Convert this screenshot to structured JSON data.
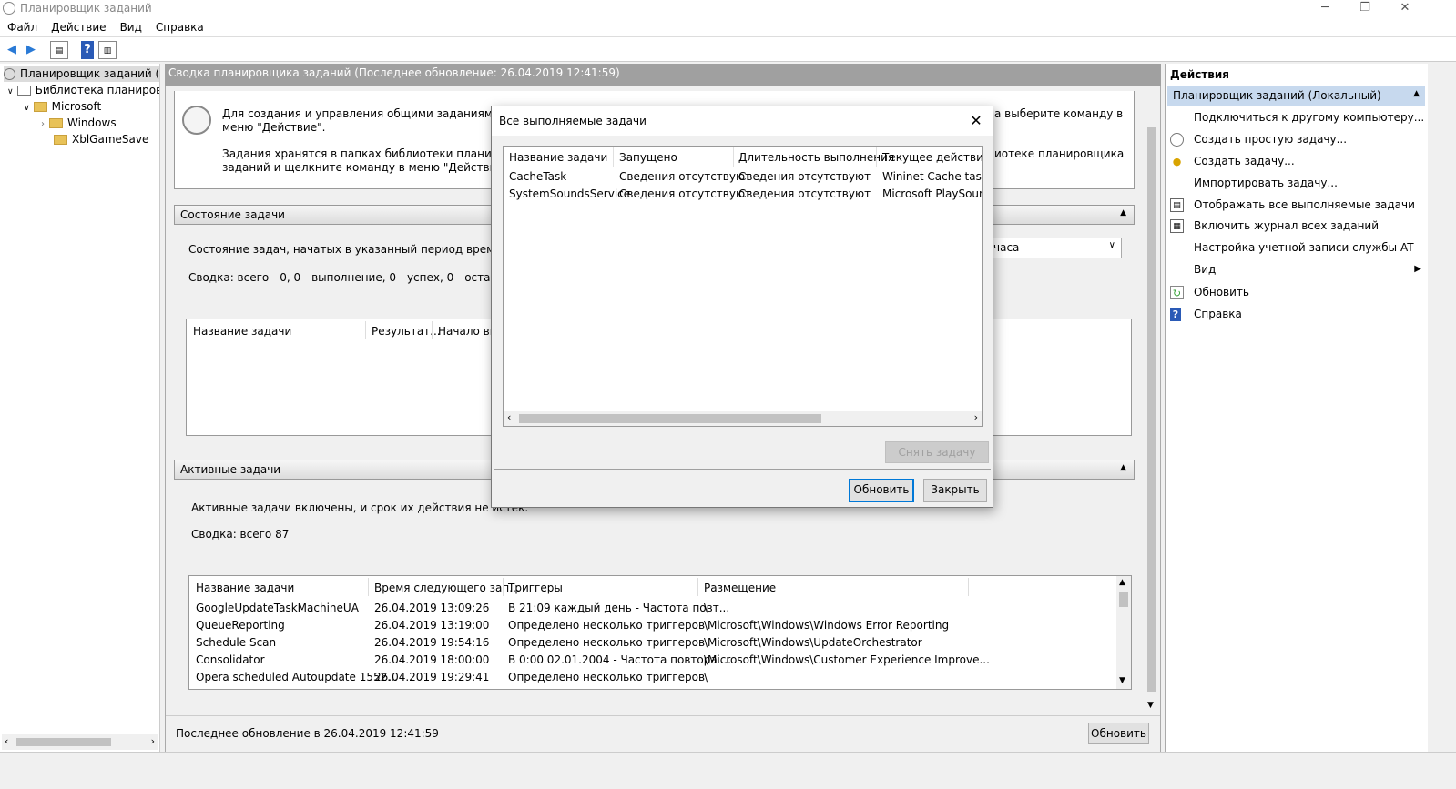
{
  "window": {
    "title": "Планировщик заданий"
  },
  "menu": [
    "Файл",
    "Действие",
    "Вид",
    "Справка"
  ],
  "tree": {
    "root": "Планировщик заданий (Локальный)",
    "library": "Библиотека планировщика заданий",
    "microsoft": "Microsoft",
    "windows": "Windows",
    "xbl": "XblGameSave"
  },
  "center": {
    "header": "Сводка планировщика заданий (Последнее обновление: 26.04.2019 12:41:59)",
    "intro": {
      "line1": "Для создания и управления общими заданиями, автом",
      "line1b": "а выберите команду в",
      "line2": "меню \"Действие\".",
      "line3": "Задания хранятся в папках библиотеки планировщика",
      "line3b": "иотеке планировщика",
      "line4": "заданий и щелкните команду в меню \"Действие\"."
    },
    "status_section": {
      "title": "Состояние задачи",
      "period_label": "Состояние задач, начатых в указанный период времени:",
      "period_value": "часа",
      "summary": "Сводка: всего - 0, 0 - выполнение, 0 - успех, 0 - остановлено, 0",
      "columns": [
        "Название задачи",
        "Результат...",
        "Начало вы"
      ]
    },
    "active_section": {
      "title": "Активные задачи",
      "desc": "Активные задачи включены, и срок их действия не истек.",
      "summary": "Сводка: всего 87",
      "columns": [
        "Название задачи",
        "Время следующего зап...",
        "Триггеры",
        "Размещение"
      ],
      "rows": [
        [
          "GoogleUpdateTaskMachineUA",
          "26.04.2019 13:09:26",
          "В 21:09 каждый день - Частота повт...",
          "\\"
        ],
        [
          "QueueReporting",
          "26.04.2019 13:19:00",
          "Определено несколько триггеров",
          "\\Microsoft\\Windows\\Windows Error Reporting"
        ],
        [
          "Schedule Scan",
          "26.04.2019 19:54:16",
          "Определено несколько триггеров",
          "\\Microsoft\\Windows\\UpdateOrchestrator"
        ],
        [
          "Consolidator",
          "26.04.2019 18:00:00",
          "В 0:00 02.01.2004 - Частота повтора ...",
          "\\Microsoft\\Windows\\Customer Experience Improve..."
        ],
        [
          "Opera scheduled Autoupdate 1552...",
          "26.04.2019 19:29:41",
          "Определено несколько триггеров",
          "\\"
        ]
      ]
    },
    "footer": {
      "last_update": "Последнее обновление в 26.04.2019 12:41:59",
      "refresh": "Обновить"
    }
  },
  "actions": {
    "title": "Действия",
    "group": "Планировщик заданий (Локальный)",
    "items": [
      {
        "label": "Подключиться к другому компьютеру...",
        "icon": "none"
      },
      {
        "label": "Создать простую задачу...",
        "icon": "clock-icon"
      },
      {
        "label": "Создать задачу...",
        "icon": "task-icon"
      },
      {
        "label": "Импортировать задачу...",
        "icon": "none"
      },
      {
        "label": "Отображать все выполняемые задачи",
        "icon": "list-icon"
      },
      {
        "label": "Включить журнал всех заданий",
        "icon": "log-icon"
      },
      {
        "label": "Настройка учетной записи службы AT",
        "icon": "none"
      },
      {
        "label": "Вид",
        "icon": "none"
      },
      {
        "label": "Обновить",
        "icon": "refresh-icon"
      },
      {
        "label": "Справка",
        "icon": "help-icon"
      }
    ]
  },
  "dialog": {
    "title": "Все выполняемые задачи",
    "columns": [
      "Название задачи",
      "Запущено",
      "Длительность выполнения",
      "Текущее действие"
    ],
    "rows": [
      [
        "CacheTask",
        "Сведения отсутствуют",
        "Сведения отсутствуют",
        "Wininet Cache task o"
      ],
      [
        "SystemSoundsService",
        "Сведения отсутствуют",
        "Сведения отсутствуют",
        "Microsoft PlaySound"
      ]
    ],
    "end_task": "Снять задачу",
    "refresh": "Обновить",
    "close": "Закрыть"
  }
}
